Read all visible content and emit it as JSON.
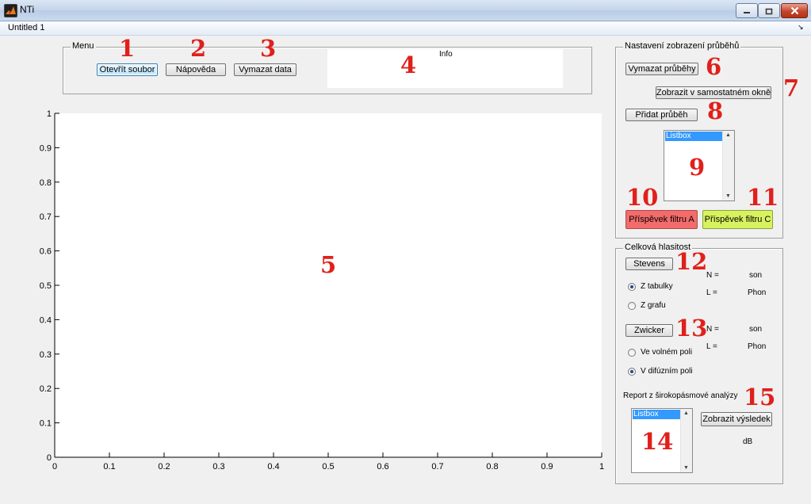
{
  "window": {
    "title": "NTi"
  },
  "menubar": {
    "label": "Untitled 1"
  },
  "menu_panel": {
    "title": "Menu",
    "open_file": "Otevřít soubor",
    "help": "Nápověda",
    "clear_data": "Vymazat data",
    "info_label": "Info"
  },
  "display_panel": {
    "title": "Nastavení zobrazení průběhů",
    "clear_curves": "Vymazat průběhy",
    "show_in_window": "Zobrazit v samostatném okně",
    "add_curve": "Přidat průběh",
    "listbox_item": "Listbox",
    "filter_a": "Příspěvek filtru A",
    "filter_c": "Příspěvek filtru C"
  },
  "loudness_panel": {
    "title": "Celková hlasitost",
    "stevens": "Stevens",
    "from_table": "Z tabulky",
    "from_graph": "Z grafu",
    "zwicker": "Zwicker",
    "free_field": "Ve volném poli",
    "diffuse_field": "V difúzním poli",
    "n_label": "N =",
    "l_label": "L =",
    "son": "son",
    "phon": "Phon",
    "report_label": "Report z širokopásmové analýzy",
    "listbox_item": "Listbox",
    "show_result": "Zobrazit výsledek",
    "db_label": "dB"
  },
  "annotations": [
    "1",
    "2",
    "3",
    "4",
    "5",
    "6",
    "7",
    "8",
    "9",
    "10",
    "11",
    "12",
    "13",
    "14",
    "15"
  ],
  "plot": {
    "x_ticks": [
      "0",
      "0.1",
      "0.2",
      "0.3",
      "0.4",
      "0.5",
      "0.6",
      "0.7",
      "0.8",
      "0.9",
      "1"
    ],
    "y_ticks": [
      "0",
      "0.1",
      "0.2",
      "0.3",
      "0.4",
      "0.5",
      "0.6",
      "0.7",
      "0.8",
      "0.9",
      "1"
    ]
  },
  "colors": {
    "filter_a": "#f36b6b",
    "filter_c": "#d8f25f",
    "annotation": "#e0201b",
    "selection": "#3399ff"
  }
}
